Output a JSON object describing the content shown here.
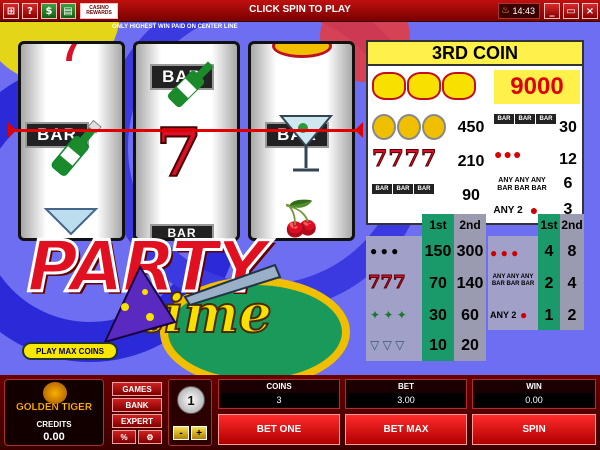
{
  "topbar": {
    "buttons": [
      "⊞",
      "?",
      "$"
    ],
    "casino_rewards": "CASINO REWARDS",
    "title": "CLICK SPIN TO PLAY",
    "clock": "14:43",
    "window_buttons": [
      "_",
      "▭",
      "×"
    ]
  },
  "game": {
    "payline_note": "ONLY HIGHEST WIN PAID ON CENTER LINE",
    "reels": [
      {
        "top": "",
        "center": "BAR",
        "bottom": "glass"
      },
      {
        "top": "BAR",
        "center": "7",
        "bottom": ""
      },
      {
        "top": "",
        "center": "BAR",
        "bottom": "cherry"
      }
    ],
    "logo_main": "PARTY",
    "logo_sub": "time",
    "play_max": "PLAY MAX COINS"
  },
  "paytable": {
    "header": "3RD COIN",
    "top_rows": [
      {
        "symbol": "party-time",
        "payout": "9000"
      },
      {
        "symbol": "bottle",
        "payout": "450"
      },
      {
        "symbol": "seven",
        "payout": "210"
      },
      {
        "symbol": "glass",
        "payout": "90"
      }
    ],
    "right_rows": [
      {
        "symbol": "bar-3",
        "payout": "30"
      },
      {
        "symbol": "cherry-3",
        "payout": "12"
      },
      {
        "symbol": "any-bar",
        "payout": "6",
        "label": "ANY ANY ANY BAR BAR BAR"
      },
      {
        "symbol": "any-2-cherry",
        "payout": "3",
        "label": "ANY 2"
      }
    ],
    "col_headers": [
      "1st",
      "2nd"
    ],
    "left_bottom": [
      {
        "c1": "150",
        "c2": "300"
      },
      {
        "c1": "70",
        "c2": "140"
      },
      {
        "c1": "30",
        "c2": "60"
      },
      {
        "c1": "10",
        "c2": "20"
      }
    ],
    "right_bottom": [
      {
        "c1": "4",
        "c2": "8",
        "label": ""
      },
      {
        "c1": "2",
        "c2": "4",
        "label": "ANY ANY ANY BAR BAR BAR"
      },
      {
        "c1": "1",
        "c2": "2",
        "label": "ANY 2"
      }
    ]
  },
  "console": {
    "brand": "GOLDEN TIGER",
    "credits_label": "CREDITS",
    "credits": "0.00",
    "side_buttons": [
      "GAMES",
      "BANK",
      "EXPERT"
    ],
    "percent": "%",
    "coin_size": "1",
    "minus": "-",
    "plus": "+",
    "coins_label": "COINS",
    "coins": "3",
    "bet_label": "BET",
    "bet": "3.00",
    "win_label": "WIN",
    "win": "0.00",
    "bet_one": "BET ONE",
    "bet_max": "BET MAX",
    "spin": "SPIN"
  },
  "colors": {
    "background": "#6e6ef2",
    "frame": "#8a0000",
    "accent_yellow": "#fff04a",
    "button_red": "#e01010"
  }
}
